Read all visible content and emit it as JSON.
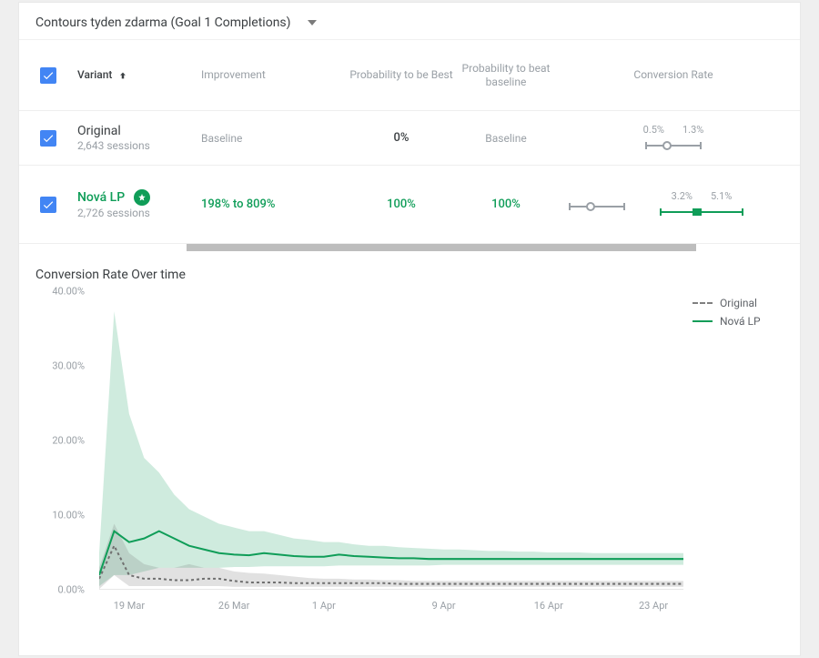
{
  "header": {
    "title": "Contours tyden zdarma (Goal 1 Completions)"
  },
  "table": {
    "cols": {
      "variant": "Variant",
      "improvement": "Improvement",
      "pbest": "Probability to be Best",
      "pbase": "Probability to beat baseline",
      "conv": "Conversion Rate"
    },
    "rows": [
      {
        "name": "Original",
        "sessions": "2,643 sessions",
        "improvement": "Baseline",
        "pbest": "0%",
        "pbase": "Baseline",
        "cr_low": "0.5%",
        "cr_high": "1.3%"
      },
      {
        "name": "Nová LP",
        "sessions": "2,726 sessions",
        "improvement": "198% to 809%",
        "pbest": "100%",
        "pbase": "100%",
        "cr_low": "3.2%",
        "cr_high": "5.1%"
      }
    ]
  },
  "chart_title": "Conversion Rate Over time",
  "legend": {
    "original": "Original",
    "nova": "Nová LP"
  },
  "chart_data": {
    "type": "line",
    "title": "Conversion Rate Over time",
    "xlabel": "",
    "ylabel": "",
    "ylim": [
      0,
      40
    ],
    "y_ticks": [
      "0.00%",
      "10.00%",
      "20.00%",
      "30.00%",
      "40.00%"
    ],
    "x_ticks": [
      "19 Mar",
      "26 Mar",
      "1 Apr",
      "9 Apr",
      "16 Apr",
      "23 Apr"
    ],
    "x": [
      0,
      1,
      2,
      3,
      4,
      5,
      6,
      7,
      8,
      9,
      10,
      11,
      12,
      13,
      14,
      15,
      16,
      17,
      18,
      19,
      20,
      21,
      22,
      23,
      24,
      25,
      26,
      27,
      28,
      29,
      30,
      31,
      32,
      33,
      34,
      35,
      36,
      37,
      38,
      39
    ],
    "series": [
      {
        "name": "Original",
        "values": [
          1.5,
          6.0,
          2.0,
          1.5,
          1.5,
          1.3,
          1.3,
          1.5,
          1.5,
          1.2,
          1.0,
          1.0,
          1.0,
          0.9,
          0.9,
          0.9,
          0.9,
          0.9,
          0.9,
          0.9,
          0.8,
          0.8,
          0.8,
          0.8,
          0.8,
          0.8,
          0.8,
          0.8,
          0.8,
          0.8,
          0.8,
          0.8,
          0.8,
          0.8,
          0.8,
          0.8,
          0.8,
          0.8,
          0.8,
          0.8
        ]
      },
      {
        "name": "Nová LP",
        "values": [
          2.0,
          8.0,
          6.5,
          7.0,
          8.0,
          7.0,
          6.0,
          5.5,
          5.0,
          4.8,
          4.7,
          5.0,
          4.8,
          4.6,
          4.5,
          4.5,
          4.8,
          4.6,
          4.5,
          4.4,
          4.3,
          4.3,
          4.2,
          4.2,
          4.2,
          4.2,
          4.2,
          4.2,
          4.2,
          4.2,
          4.2,
          4.2,
          4.2,
          4.2,
          4.2,
          4.2,
          4.2,
          4.2,
          4.2,
          4.2
        ]
      }
    ],
    "bands": [
      {
        "name": "Original",
        "upper": [
          3.0,
          9.0,
          5.0,
          3.5,
          3.0,
          3.0,
          3.5,
          3.0,
          3.0,
          2.5,
          2.3,
          2.2,
          2.0,
          1.8,
          1.6,
          1.5,
          1.5,
          1.4,
          1.4,
          1.3,
          1.3,
          1.2,
          1.2,
          1.2,
          1.2,
          1.2,
          1.2,
          1.2,
          1.2,
          1.2,
          1.2,
          1.2,
          1.2,
          1.2,
          1.2,
          1.2,
          1.2,
          1.2,
          1.2,
          1.2
        ],
        "lower": [
          0.1,
          2.0,
          0.5,
          0.5,
          0.5,
          0.5,
          0.5,
          0.5,
          0.5,
          0.4,
          0.4,
          0.4,
          0.4,
          0.4,
          0.4,
          0.4,
          0.4,
          0.4,
          0.4,
          0.4,
          0.4,
          0.4,
          0.4,
          0.4,
          0.4,
          0.4,
          0.4,
          0.4,
          0.4,
          0.4,
          0.4,
          0.4,
          0.4,
          0.4,
          0.4,
          0.4,
          0.4,
          0.4,
          0.4,
          0.4
        ]
      },
      {
        "name": "Nová LP",
        "upper": [
          5.0,
          38.0,
          24.0,
          18.0,
          16.0,
          13.0,
          11.0,
          10.0,
          9.0,
          8.5,
          8.0,
          8.0,
          7.5,
          7.0,
          6.8,
          6.5,
          6.5,
          6.2,
          6.0,
          6.0,
          5.8,
          5.7,
          5.6,
          5.5,
          5.5,
          5.4,
          5.3,
          5.3,
          5.2,
          5.2,
          5.1,
          5.1,
          5.1,
          5.0,
          5.0,
          5.0,
          5.0,
          5.0,
          5.0,
          5.0
        ],
        "lower": [
          0.5,
          2.0,
          2.0,
          2.5,
          3.0,
          3.0,
          3.0,
          3.0,
          3.0,
          3.1,
          3.1,
          3.2,
          3.2,
          3.2,
          3.2,
          3.2,
          3.3,
          3.3,
          3.3,
          3.3,
          3.3,
          3.3,
          3.3,
          3.4,
          3.4,
          3.4,
          3.4,
          3.4,
          3.4,
          3.4,
          3.4,
          3.4,
          3.4,
          3.4,
          3.4,
          3.4,
          3.4,
          3.4,
          3.4,
          3.4
        ]
      }
    ]
  }
}
